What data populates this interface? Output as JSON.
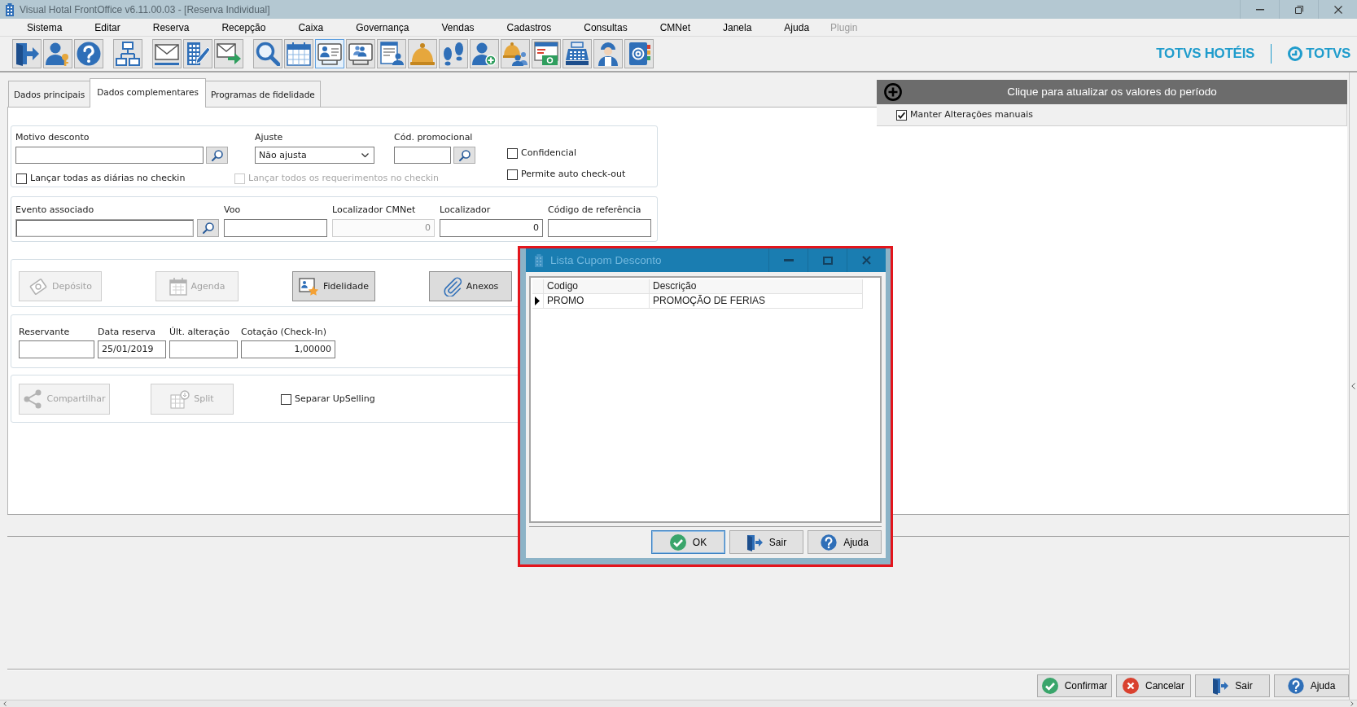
{
  "window": {
    "title": "Visual Hotal FrontOffice v6.11.00.03 - [Reserva Individual]"
  },
  "menu": [
    {
      "label": "Sistema",
      "disabled": false
    },
    {
      "label": "Editar",
      "disabled": false
    },
    {
      "label": "Reserva",
      "disabled": false
    },
    {
      "label": "Recepção",
      "disabled": false
    },
    {
      "label": "Caixa",
      "disabled": false
    },
    {
      "label": "Governança",
      "disabled": false
    },
    {
      "label": "Vendas",
      "disabled": false
    },
    {
      "label": "Cadastros",
      "disabled": false
    },
    {
      "label": "Consultas",
      "disabled": false
    },
    {
      "label": "CMNet",
      "disabled": false
    },
    {
      "label": "Janela",
      "disabled": false
    },
    {
      "label": "Ajuda",
      "disabled": false
    },
    {
      "label": "Plugin",
      "disabled": true
    }
  ],
  "toolbar": [
    {
      "selected": false
    },
    {
      "selected": false
    },
    {
      "selected": false
    },
    {
      "selected": false
    },
    {
      "selected": false
    },
    {
      "selected": false
    },
    {
      "selected": false
    },
    {
      "selected": false
    },
    {
      "selected": false
    },
    {
      "selected": true
    },
    {
      "selected": false
    },
    {
      "selected": false
    },
    {
      "selected": false
    },
    {
      "selected": false
    },
    {
      "selected": false
    },
    {
      "selected": false
    },
    {
      "selected": false
    },
    {
      "selected": false
    },
    {
      "selected": false
    },
    {
      "selected": false
    }
  ],
  "brand": {
    "product": "TOTVS HOTÉIS",
    "company": "TOTVS"
  },
  "tabs": [
    {
      "label": "Dados principais",
      "selected": false
    },
    {
      "label": "Dados complementares",
      "selected": true
    },
    {
      "label": "Programas de fidelidade",
      "selected": false
    }
  ],
  "discount": {
    "reason": {
      "label": "Motivo desconto"
    },
    "adjust": {
      "label": "Ajuste",
      "value": "Não ajusta"
    },
    "promo_code": {
      "label": "Cód. promocional"
    },
    "confidential": {
      "label": "Confidencial",
      "checked": false
    },
    "auto_checkout": {
      "label": "Permite auto check-out",
      "checked": false
    },
    "post_all_rates": {
      "label": "Lançar todas as diárias no checkin",
      "checked": false,
      "disabled": false
    },
    "post_all_requirements": {
      "label": "Lançar todos os requerimentos no checkin",
      "checked": false,
      "disabled": true
    }
  },
  "references": [
    {
      "kind": "lookup",
      "label": "Evento associado",
      "disabled": false
    },
    {
      "kind": "text",
      "label": "Voo",
      "disabled": false
    },
    {
      "kind": "number",
      "label": "Localizador CMNet",
      "value": "0",
      "disabled": true
    },
    {
      "kind": "number",
      "label": "Localizador",
      "value": "0",
      "disabled": false
    },
    {
      "kind": "text",
      "label": "Código de referência",
      "disabled": false
    }
  ],
  "actions": [
    {
      "kind": "deposit",
      "label": "Depósito",
      "disabled": true
    },
    {
      "kind": "agenda",
      "label": "Agenda",
      "disabled": true
    },
    {
      "kind": "loyalty",
      "label": "Fidelidade",
      "disabled": false
    },
    {
      "kind": "attachments",
      "label": "Anexos",
      "disabled": false
    }
  ],
  "booking": [
    {
      "kind": "text",
      "label": "Reservante"
    },
    {
      "kind": "date",
      "label": "Data reserva",
      "value": "25/01/2019"
    },
    {
      "kind": "text",
      "label": "Últ. alteração"
    },
    {
      "kind": "number",
      "label": "Cotação (Check-In)",
      "value": "1,00000"
    }
  ],
  "sharing": {
    "buttons": [
      {
        "kind": "share",
        "label": "Compartilhar",
        "disabled": true
      },
      {
        "kind": "split",
        "label": "Split",
        "disabled": true
      }
    ],
    "upselling": {
      "label": "Separar UpSelling",
      "checked": false
    }
  },
  "rate_panel": {
    "header": "Clique para atualizar os valores do período",
    "keep_manual": {
      "label": "Manter Alterações manuais",
      "checked": true
    }
  },
  "dialog": {
    "outlined": true,
    "title": "Lista Cupom Desconto",
    "columns": [
      "Codigo",
      "Descrição"
    ],
    "rows": [
      {
        "selected": true,
        "cells": [
          "PROMO",
          "PROMOÇÃO DE FERIAS"
        ]
      }
    ],
    "buttons": [
      {
        "kind": "ok",
        "label": "OK",
        "default": true
      },
      {
        "kind": "exit",
        "label": "Sair",
        "default": false
      },
      {
        "kind": "help",
        "label": "Ajuda",
        "default": false
      }
    ]
  },
  "footer_buttons": [
    {
      "kind": "confirm",
      "label": "Confirmar"
    },
    {
      "kind": "cancel",
      "label": "Cancelar"
    },
    {
      "kind": "exit",
      "label": "Sair"
    },
    {
      "kind": "help",
      "label": "Ajuda"
    }
  ]
}
